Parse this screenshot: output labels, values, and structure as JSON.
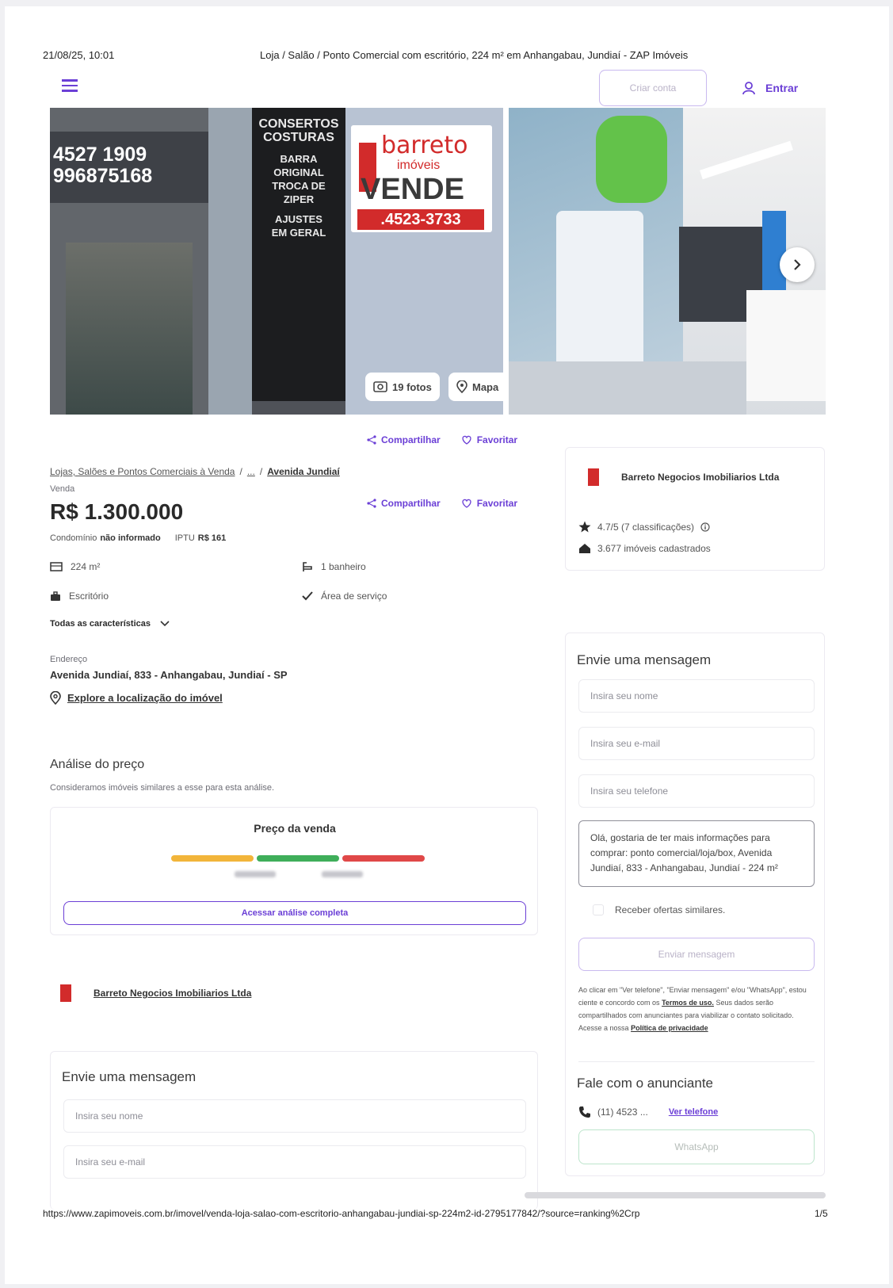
{
  "print_header": {
    "datetime": "21/08/25, 10:01",
    "title": "Loja / Salão / Ponto Comercial com escritório, 224 m² em Anhangabau, Jundiaí - ZAP Imóveis"
  },
  "nav": {
    "create_account_label": "Criar conta",
    "login_label": "Entrar"
  },
  "gallery": {
    "photos_label": "19 fotos",
    "map_label": "Mapa",
    "sign": {
      "phone1": "4527 1909",
      "phone2": "996875168",
      "store_lines": [
        "CONSERTOS",
        "COSTURAS",
        "BARRA",
        "ORIGINAL",
        "TROCA DE",
        "ZIPER",
        "AJUSTES",
        "EM GERAL"
      ],
      "brand": "barreto",
      "brand_sub": "imóveis",
      "vende": "VENDE",
      "sign_phone": ".4523-3733"
    }
  },
  "actions": {
    "share_label": "Compartilhar",
    "favorite_label": "Favoritar"
  },
  "breadcrumb": {
    "category": "Lojas, Salões e Pontos Comerciais à Venda",
    "sep": "/",
    "ellipsis": "...",
    "street": "Avenida Jundiaí"
  },
  "listing": {
    "type_label": "Venda",
    "price": "R$ 1.300.000",
    "condo_label": "Condomínio",
    "condo_value": "não informado",
    "iptu_label": "IPTU",
    "iptu_value": "R$ 161",
    "features": {
      "area": "224 m²",
      "bathrooms": "1 banheiro",
      "office": "Escritório",
      "service_area": "Área de serviço"
    },
    "all_features_label": "Todas as características",
    "address_label": "Endereço",
    "address": "Avenida Jundiaí, 833 - Anhangabau, Jundiaí - SP",
    "explore_label": "Explore a localização do imóvel"
  },
  "price_analysis": {
    "title": "Análise do preço",
    "subtitle": "Consideramos imóveis similares a esse para esta análise.",
    "card_title": "Preço da venda",
    "bar_colors": [
      "#f2b53a",
      "#3fae5a",
      "#e04848"
    ],
    "button_label": "Acessar análise completa"
  },
  "advertiser": {
    "name": "Barreto Negocios Imobiliarios Ltda",
    "rating": "4.7/5 (7 classificações)",
    "listings": "3.677 imóveis cadastrados"
  },
  "message_form": {
    "title": "Envie uma mensagem",
    "name_placeholder": "Insira seu nome",
    "email_placeholder": "Insira seu e-mail",
    "phone_placeholder": "Insira seu telefone",
    "message_text": "Olá, gostaria de ter mais informações para comprar: ponto comercial/loja/box, Avenida Jundiaí, 833 - Anhangabau, Jundiaí - 224 m²",
    "similar_offers_label": "Receber ofertas similares.",
    "submit_label": "Enviar mensagem",
    "legal_text": "Ao clicar em \"Ver telefone\", \"Enviar mensagem\" e/ou \"WhatsApp\", estou ciente e concordo com os",
    "terms_label": "Termos de uso.",
    "legal_text2": "Seus dados serão compartilhados com anunciantes para viabilizar o contato solicitado. Acesse a nossa",
    "privacy_label": "Política de privacidade"
  },
  "contact": {
    "title": "Fale com o anunciante",
    "phone": "(11) 4523 ...",
    "show_phone_label": "Ver telefone",
    "whatsapp_label": "WhatsApp"
  },
  "bottom_form": {
    "title": "Envie uma mensagem",
    "name_placeholder": "Insira seu nome",
    "email_placeholder": "Insira seu e-mail"
  },
  "print_footer": {
    "url": "https://www.zapimoveis.com.br/imovel/venda-loja-salao-com-escritorio-anhangabau-jundiai-sp-224m2-id-2795177842/?source=ranking%2Crp",
    "page": "1/5"
  }
}
